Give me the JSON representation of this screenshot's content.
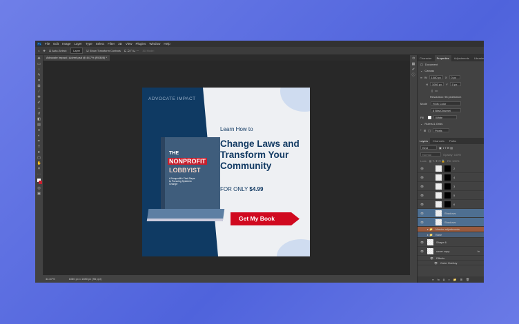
{
  "menu": [
    "File",
    "Edit",
    "Image",
    "Layer",
    "Type",
    "Select",
    "Filter",
    "3D",
    "View",
    "Plugins",
    "Window",
    "Help"
  ],
  "options": {
    "auto_select": "Auto-Select:",
    "auto_select_value": "Layer",
    "show_transform": "Show Transform Controls",
    "mode_3d": "3D Mode:"
  },
  "doc_tab": "Advocate Impact | Advert.psd @ 44.7% (RGB/8) *",
  "status": {
    "zoom": "44.67%",
    "size": "1080 px x 1080 px (96 ppi)"
  },
  "panel": {
    "tabs": [
      "Character",
      "Properties",
      "Adjustments",
      "Libraries"
    ],
    "doc_label": "Document",
    "canvas_header": "Canvas",
    "w": "1080 px",
    "h": "1080 px",
    "x": "0 px",
    "y": "0 px",
    "resolution": "Resolution: 96 pixels/inch",
    "mode_label": "Mode",
    "mode": "RGB Color",
    "depth": "8 Bits/Channel",
    "fill_label": "Fill",
    "fill": "White",
    "rulers_header": "Rulers & Grids",
    "units": "Pixels"
  },
  "layers": {
    "tabs": [
      "Layers",
      "Channels",
      "Paths"
    ],
    "kind": "Kind",
    "blend": "Normal",
    "opacity": "Opacity: 100%",
    "lock": "Lock:",
    "fill": "Fill: 100%",
    "items": [
      {
        "name": "2"
      },
      {
        "name": "4"
      },
      {
        "name": "3"
      },
      {
        "name": "5"
      },
      {
        "name": "6"
      },
      {
        "name": "Shadows"
      },
      {
        "name": "Shadows"
      },
      {
        "name": "Master adjustments"
      },
      {
        "name": "Base"
      },
      {
        "name": "Shape 6"
      },
      {
        "name": "cover copy"
      },
      {
        "name": "Effects"
      },
      {
        "name": "Color Overlay"
      }
    ]
  },
  "ad": {
    "brand": "ADVOCATE IMPACT",
    "learn": "Learn How to",
    "headline": "Change Laws and Transform Your Community",
    "price_prefix": "FOR ONLY",
    "price": "$4.99",
    "cta": "Get My Book",
    "book": {
      "the": "THE",
      "title1": "NONPROFIT",
      "title2": "LOBBYIST",
      "subtitle": "A Nonprofit's First Steps to Pursuing Systemic Change"
    }
  }
}
